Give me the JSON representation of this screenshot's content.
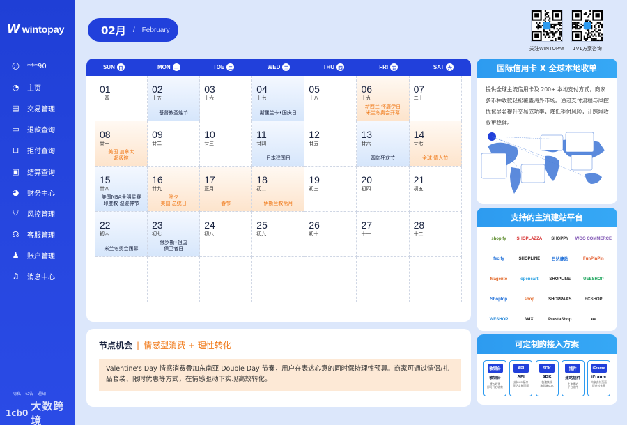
{
  "brand": {
    "logo_mark": "W",
    "name": "wintopay"
  },
  "sidebar": {
    "items": [
      {
        "label": "***90",
        "icon": "user-icon"
      },
      {
        "label": "主页",
        "icon": "dashboard-icon"
      },
      {
        "label": "交易管理",
        "icon": "transaction-icon"
      },
      {
        "label": "退款查询",
        "icon": "refund-icon"
      },
      {
        "label": "拒付查询",
        "icon": "chargeback-icon"
      },
      {
        "label": "结算查询",
        "icon": "settlement-icon"
      },
      {
        "label": "财务中心",
        "icon": "pie-chart-icon"
      },
      {
        "label": "风控管理",
        "icon": "shield-icon"
      },
      {
        "label": "客服管理",
        "icon": "headset-icon"
      },
      {
        "label": "账户管理",
        "icon": "account-icon"
      },
      {
        "label": "消息中心",
        "icon": "bell-icon"
      }
    ],
    "footer_links": [
      "隐私",
      "公告",
      "通知"
    ],
    "watermark_logo": "1cb0",
    "watermark_text": "大数跨境"
  },
  "month": {
    "num": "02月",
    "sep": "/",
    "en": "February"
  },
  "qr": [
    {
      "label": "关注WINTOPAY"
    },
    {
      "label": "1V1方案咨询"
    }
  ],
  "calendar": {
    "weekdays": [
      {
        "en": "SUN",
        "cn": "日"
      },
      {
        "en": "MON",
        "cn": "一"
      },
      {
        "en": "TOE",
        "cn": "二"
      },
      {
        "en": "WED",
        "cn": "三"
      },
      {
        "en": "THU",
        "cn": "四"
      },
      {
        "en": "FRI",
        "cn": "五"
      },
      {
        "en": "SAT",
        "cn": "六"
      }
    ],
    "days": [
      {
        "date": "01",
        "lunar": "十四",
        "event": "",
        "style": ""
      },
      {
        "date": "02",
        "lunar": "十五",
        "event": "基督教圣烛节",
        "style": "blue"
      },
      {
        "date": "03",
        "lunar": "十六",
        "event": "",
        "style": ""
      },
      {
        "date": "04",
        "lunar": "十七",
        "event": "斯里兰卡•国庆日",
        "style": "blue"
      },
      {
        "date": "05",
        "lunar": "十八",
        "event": "",
        "style": ""
      },
      {
        "date": "06",
        "lunar": "十九",
        "event": "新西兰 怀唐伊日\n米兰冬奥会开幕",
        "style": "orange"
      },
      {
        "date": "07",
        "lunar": "二十",
        "event": "",
        "style": ""
      },
      {
        "date": "08",
        "lunar": "廿一",
        "event": "美国 加拿大\n超级碗",
        "style": "orange"
      },
      {
        "date": "09",
        "lunar": "廿二",
        "event": "",
        "style": ""
      },
      {
        "date": "10",
        "lunar": "廿三",
        "event": "",
        "style": ""
      },
      {
        "date": "11",
        "lunar": "廿四",
        "event": "日本建国日",
        "style": "blue"
      },
      {
        "date": "12",
        "lunar": "廿五",
        "event": "",
        "style": ""
      },
      {
        "date": "13",
        "lunar": "廿六",
        "event": "四旬狂欢节",
        "style": "blue"
      },
      {
        "date": "14",
        "lunar": "廿七",
        "event": "全球 情人节",
        "style": "orange"
      },
      {
        "date": "15",
        "lunar": "廿八",
        "event": "美国NBA全明星赛\n印度教 湿婆神节",
        "style": "blue"
      },
      {
        "date": "16",
        "lunar": "廿九",
        "event": "除夕\n美国 总统日",
        "style": "orange"
      },
      {
        "date": "17",
        "lunar": "正月",
        "event": "春节",
        "style": "orange"
      },
      {
        "date": "18",
        "lunar": "初二",
        "event": "伊斯兰教斋月",
        "style": "orange"
      },
      {
        "date": "19",
        "lunar": "初三",
        "event": "",
        "style": ""
      },
      {
        "date": "20",
        "lunar": "初四",
        "event": "",
        "style": ""
      },
      {
        "date": "21",
        "lunar": "初五",
        "event": "",
        "style": ""
      },
      {
        "date": "22",
        "lunar": "初六",
        "event": "米兰冬奥会闭幕",
        "style": "blue"
      },
      {
        "date": "23",
        "lunar": "初七",
        "event": "俄罗斯•祖国\n保卫者日",
        "style": "blue"
      },
      {
        "date": "24",
        "lunar": "初八",
        "event": "",
        "style": ""
      },
      {
        "date": "25",
        "lunar": "初九",
        "event": "",
        "style": ""
      },
      {
        "date": "26",
        "lunar": "初十",
        "event": "",
        "style": ""
      },
      {
        "date": "27",
        "lunar": "十一",
        "event": "",
        "style": ""
      },
      {
        "date": "28",
        "lunar": "十二",
        "event": "",
        "style": ""
      }
    ]
  },
  "opportunity": {
    "title": "节点机会",
    "sep": "|",
    "subtitle": "情感型消费 + 理性转化",
    "body": "Valentine's Day 情感消费叠加东南亚 Double Day 节奏，用户在表达心意的同时保持理性预算。商家可通过情侣/礼品套装、限时优惠等方式，在情感驱动下实现高效转化。"
  },
  "panel_cards": {
    "title": "国际信用卡 X 全球本地收单",
    "text": "提供全球主流信用卡及 200+ 本地支付方式，商家多币种收款轻松覆盖海外市场。通过支付流程与风控优化显著提升交易成功率，降低拒付风险，让跨境收款更稳健。"
  },
  "panel_platforms": {
    "title": "支持的主流建站平台",
    "items": [
      {
        "label": "shopify",
        "color": "#5a8a2a"
      },
      {
        "label": "SHOPLAZZA",
        "color": "#d63030"
      },
      {
        "label": "SHOPPY",
        "color": "#333333"
      },
      {
        "label": "WOO COMMERCE",
        "color": "#7f54b3"
      },
      {
        "label": "fecify",
        "color": "#1e6fd9"
      },
      {
        "label": "SHOPLINE",
        "color": "#222222"
      },
      {
        "label": "日达建站",
        "color": "#1e6fd9"
      },
      {
        "label": "FunPinPin",
        "color": "#e25a2a"
      },
      {
        "label": "Magento",
        "color": "#e2692a"
      },
      {
        "label": "opencart",
        "color": "#2aa0e2"
      },
      {
        "label": "SHOPLINE",
        "color": "#222222"
      },
      {
        "label": "UEESHOP",
        "color": "#1aa35a"
      },
      {
        "label": "Shoptop",
        "color": "#1e6fd9"
      },
      {
        "label": "shop",
        "color": "#e2692a"
      },
      {
        "label": "SHOPPAAS",
        "color": "#222222"
      },
      {
        "label": "ECSHOP",
        "color": "#333333"
      },
      {
        "label": "WESHOP",
        "color": "#2a8ad9"
      },
      {
        "label": "WiX",
        "color": "#111111"
      },
      {
        "label": "PrestaShop",
        "color": "#333333"
      },
      {
        "label": "•••",
        "color": "#333333"
      }
    ]
  },
  "panel_solutions": {
    "title": "可定制的接入方案",
    "items": [
      {
        "icon": "收银台",
        "name": "收银台",
        "desc": "接入收银\n即可开启收款"
      },
      {
        "icon": "API",
        "name": "API",
        "desc": "支持API接口\n灵活定制页面"
      },
      {
        "icon": "SDK",
        "name": "SDK",
        "desc": "快速集成\n移动端SDK"
      },
      {
        "icon": "插件",
        "name": "建站插件",
        "desc": "主流建站\n平台插件"
      },
      {
        "icon": "iFrame",
        "name": "iFrame",
        "desc": "内嵌支付页面\n提升转化率"
      }
    ]
  }
}
